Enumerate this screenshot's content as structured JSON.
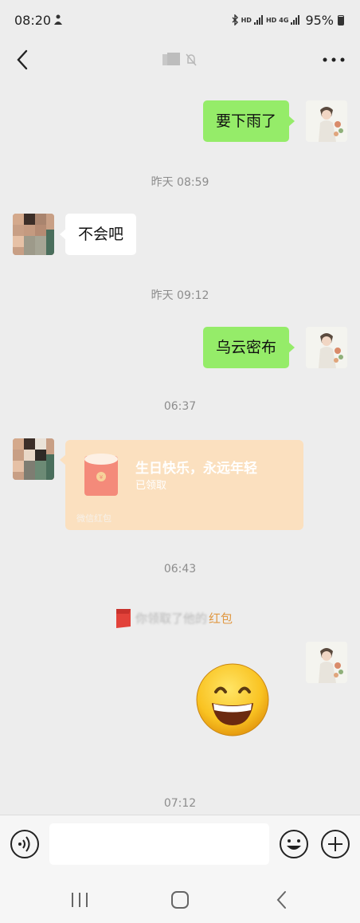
{
  "status_bar": {
    "time": "08:20",
    "hd1": "HD",
    "hd2": "HD",
    "net": "4G",
    "battery": "95%"
  },
  "header": {
    "title": ""
  },
  "messages": {
    "msg1": "要下雨了",
    "ts1": "昨天 08:59",
    "msg2": "不会吧",
    "ts2": "昨天 09:12",
    "msg3": "乌云密布",
    "ts3": "06:37",
    "red_packet": {
      "title": "生日快乐，永远年轻",
      "status": "已领取",
      "footer": "微信红包"
    },
    "ts4": "06:43",
    "system_note": {
      "text": "你领取了他的",
      "link": "红包"
    },
    "ts5": "07:12"
  },
  "input": {
    "value": "",
    "placeholder": ""
  },
  "colors": {
    "my_bubble": "#95ec69",
    "other_bubble": "#ffffff",
    "red_packet_bg": "#fbe0bf",
    "red_packet_link": "#e09842",
    "background": "#ededed"
  },
  "icons": [
    "back-arrow-icon",
    "muted-bell-icon",
    "more-dots-icon",
    "voice-icon",
    "emoji-icon",
    "plus-icon",
    "red-envelope-icon",
    "grinning-face-emoji"
  ]
}
